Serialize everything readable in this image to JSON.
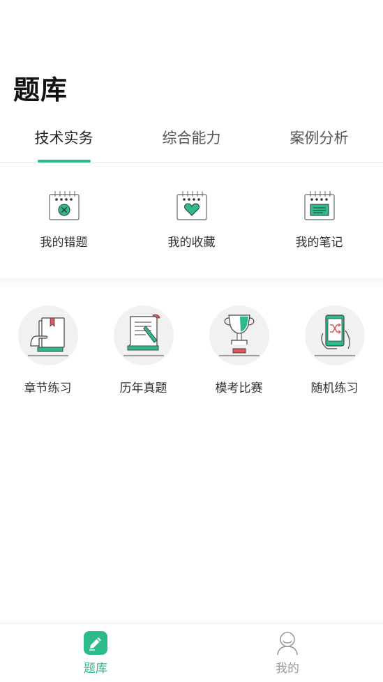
{
  "page": {
    "title": "题库"
  },
  "colors": {
    "accent": "#2dba8c",
    "inactive": "#999999"
  },
  "tabs": [
    {
      "label": "技术实务",
      "active": true
    },
    {
      "label": "综合能力",
      "active": false
    },
    {
      "label": "案例分析",
      "active": false
    }
  ],
  "quick_actions": [
    {
      "label": "我的错题",
      "icon": "wrong-questions-calendar-icon"
    },
    {
      "label": "我的收藏",
      "icon": "favorites-heart-calendar-icon"
    },
    {
      "label": "我的笔记",
      "icon": "notes-calendar-icon"
    }
  ],
  "practice": [
    {
      "label": "章节练习",
      "icon": "chapter-book-icon"
    },
    {
      "label": "历年真题",
      "icon": "past-exam-paper-icon"
    },
    {
      "label": "模考比赛",
      "icon": "trophy-icon"
    },
    {
      "label": "随机练习",
      "icon": "shuffle-phone-icon"
    }
  ],
  "bottom_nav": [
    {
      "label": "题库",
      "icon": "pencil-icon",
      "active": true
    },
    {
      "label": "我的",
      "icon": "user-icon",
      "active": false
    }
  ]
}
